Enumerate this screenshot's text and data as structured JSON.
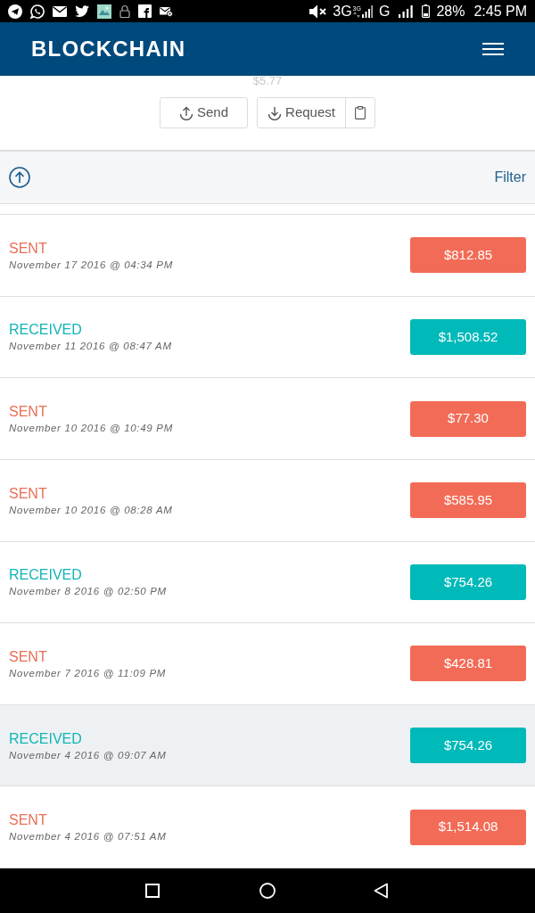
{
  "status_bar": {
    "network": "3G",
    "network_small": "3G",
    "network_second": "G",
    "battery": "28%",
    "time": "2:45 PM"
  },
  "header": {
    "logo": "BLOCKCHAIN"
  },
  "balance": {
    "amount": "$5.77"
  },
  "actions": {
    "send": "Send",
    "request": "Request"
  },
  "toolbar": {
    "filter": "Filter"
  },
  "transactions": [
    {
      "kind": "sent",
      "label": "SENT",
      "date": "November 17 2016 @ 04:34 PM",
      "amount": "$812.85",
      "selected": false
    },
    {
      "kind": "received",
      "label": "RECEIVED",
      "date": "November 11 2016 @ 08:47 AM",
      "amount": "$1,508.52",
      "selected": false
    },
    {
      "kind": "sent",
      "label": "SENT",
      "date": "November 10 2016 @ 10:49 PM",
      "amount": "$77.30",
      "selected": false
    },
    {
      "kind": "sent",
      "label": "SENT",
      "date": "November 10 2016 @ 08:28 AM",
      "amount": "$585.95",
      "selected": false
    },
    {
      "kind": "received",
      "label": "RECEIVED",
      "date": "November 8 2016 @ 02:50 PM",
      "amount": "$754.26",
      "selected": false
    },
    {
      "kind": "sent",
      "label": "SENT",
      "date": "November 7 2016 @ 11:09 PM",
      "amount": "$428.81",
      "selected": false
    },
    {
      "kind": "received",
      "label": "RECEIVED",
      "date": "November 4 2016 @ 09:07 AM",
      "amount": "$754.26",
      "selected": true
    },
    {
      "kind": "sent",
      "label": "SENT",
      "date": "November 4 2016 @ 07:51 AM",
      "amount": "$1,514.08",
      "selected": false
    }
  ]
}
